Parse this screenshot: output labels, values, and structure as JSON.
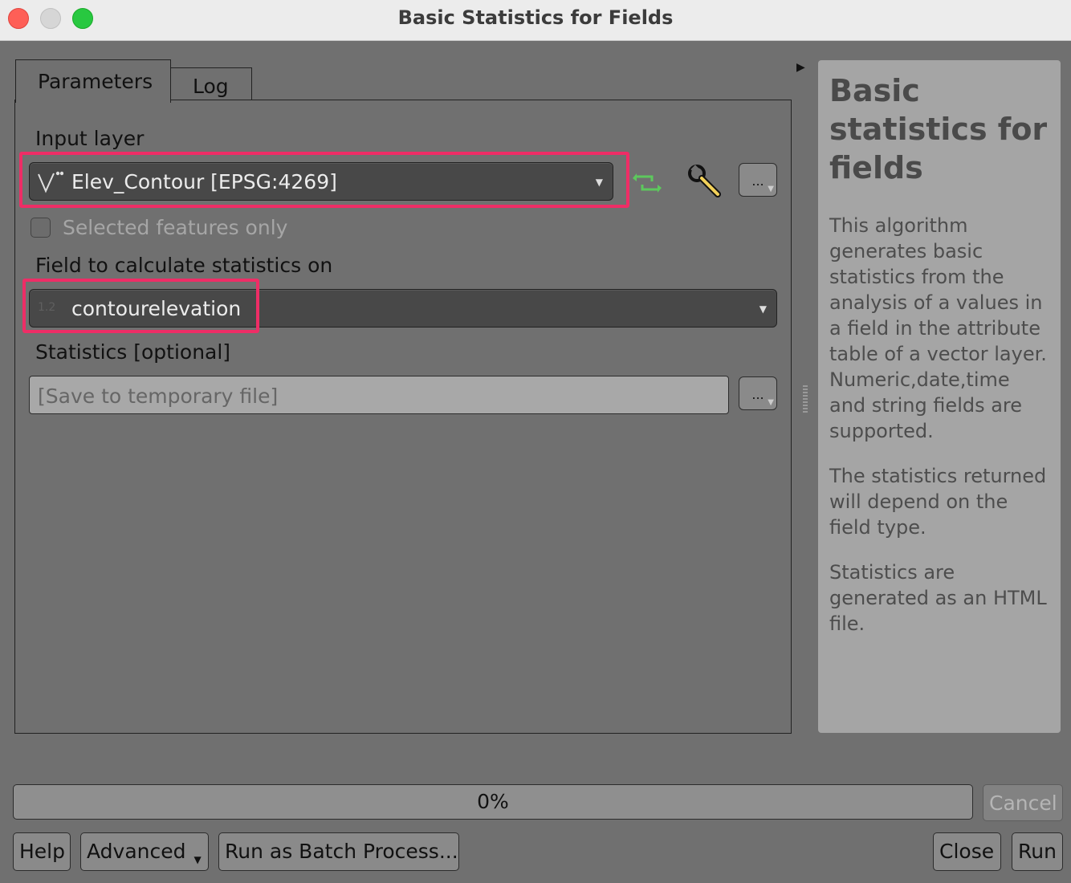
{
  "window": {
    "title": "Basic Statistics for Fields"
  },
  "tabs": [
    {
      "label": "Parameters",
      "active": true
    },
    {
      "label": "Log",
      "active": false
    }
  ],
  "params": {
    "input_layer_label": "Input layer",
    "input_layer_value": "Elev_Contour [EPSG:4269]",
    "selected_features_label": "Selected features only",
    "selected_features_checked": false,
    "field_label": "Field to calculate statistics on",
    "field_type_glyph": "1.2",
    "field_value": "contourelevation",
    "statistics_label": "Statistics [optional]",
    "statistics_placeholder": "[Save to temporary file]",
    "browse_label": "..."
  },
  "help": {
    "title": "Basic statistics for fields",
    "paragraphs": [
      "This algorithm generates basic statistics from the analysis of a values in a field in the attribute table of a vector layer. Numeric,date,time and string fields are supported.",
      "The statistics returned will depend on the field type.",
      "Statistics are generated as an HTML file."
    ]
  },
  "progress": {
    "percent": 0,
    "text": "0%"
  },
  "buttons": {
    "cancel": "Cancel",
    "help": "Help",
    "advanced": "Advanced",
    "batch": "Run as Batch Process...",
    "close": "Close",
    "run": "Run"
  },
  "colors": {
    "highlight": "#ee2d66",
    "refresh_icon": "#5dc85d",
    "traffic_red": "#fe5f57",
    "traffic_gray": "#d6d6d6",
    "traffic_green": "#28c840"
  }
}
